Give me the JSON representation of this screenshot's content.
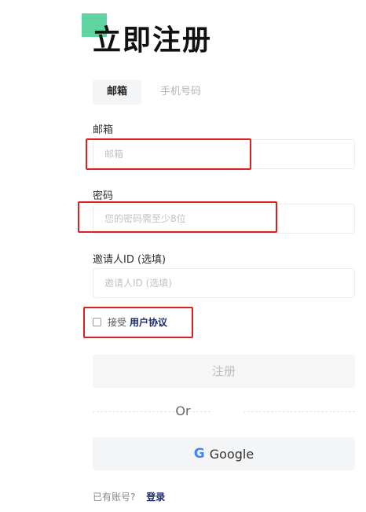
{
  "page": {
    "title": "立即注册"
  },
  "tabs": [
    {
      "label": "邮箱",
      "active": true
    },
    {
      "label": "手机号码",
      "active": false
    }
  ],
  "fields": {
    "email": {
      "label": "邮箱",
      "placeholder": "邮箱"
    },
    "password": {
      "label": "密码",
      "placeholder": "您的密码需至少8位"
    },
    "inviter": {
      "label": "邀请人ID (选填)",
      "placeholder": "邀请人ID (选填)"
    }
  },
  "agreement": {
    "prefix": "接受",
    "link": "用户协议",
    "checked": false
  },
  "register_button": "注册",
  "divider_text": "Or",
  "google_button": {
    "icon": "G",
    "label": "Google"
  },
  "login": {
    "question": "已有账号?",
    "link": "登录"
  },
  "colors": {
    "annotation": "#e02020",
    "accent_link": "#1a2b6b",
    "badge": "#5fd4a0"
  }
}
